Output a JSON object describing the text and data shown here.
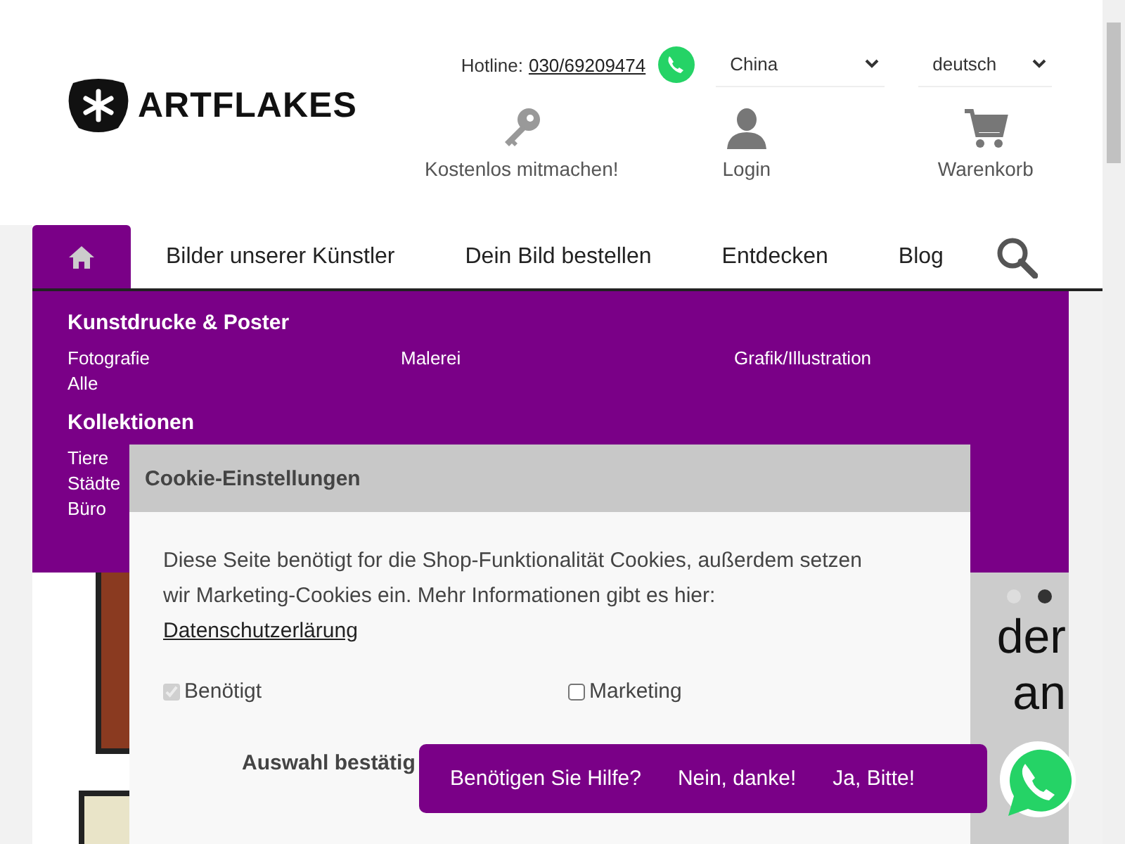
{
  "header": {
    "logo": "ARTFLAKES",
    "hotline_label": "Hotline:",
    "hotline_number": "030/69209474",
    "country": "China",
    "language": "deutsch",
    "actions": [
      {
        "kind": "key",
        "label": "Kostenlos mitmachen!"
      },
      {
        "kind": "user",
        "label": "Login"
      },
      {
        "kind": "cart",
        "label": "Warenkorb"
      }
    ]
  },
  "nav": {
    "items": [
      {
        "kind": "home",
        "selected": true
      },
      {
        "kind": "text",
        "label": "Bilder unserer Künstler",
        "selected": false
      },
      {
        "kind": "text",
        "label": "Dein Bild bestellen",
        "selected": false
      },
      {
        "kind": "text",
        "label": "Entdecken",
        "selected": false
      },
      {
        "kind": "text",
        "label": "Blog",
        "selected": false
      },
      {
        "kind": "search",
        "selected": false
      }
    ]
  },
  "mega_menu": {
    "sections": [
      {
        "title": "Kunstdrucke & Poster",
        "links": [
          "Fotografie",
          "Malerei",
          "Grafik/Illustration",
          "Alle"
        ],
        "kind": "grid"
      },
      {
        "title": "Kollektionen",
        "links": [
          "Tiere",
          "Städte",
          "Büro"
        ],
        "kind": "list"
      }
    ]
  },
  "hero": {
    "dots": [
      {
        "selected": false
      },
      {
        "selected": true
      }
    ],
    "text_lines": [
      "der",
      "an"
    ]
  },
  "cookie_dialog": {
    "title": "Cookie-Einstellungen",
    "text": "Diese Seite benötigt for die Shop-Funktionalität Cookies, außerdem setzen wir Marketing-Cookies ein. Mehr Informationen gibt es hier:",
    "link": "Datenschutzerlärung",
    "options": [
      {
        "label": "Benötigt",
        "checked": true,
        "disabled": true
      },
      {
        "label": "Marketing",
        "checked": false,
        "disabled": false
      }
    ],
    "confirm": "Auswahl bestätig"
  },
  "help_bar": {
    "question": "Benötigen Sie Hilfe?",
    "no": "Nein, danke!",
    "yes": "Ja, Bitte!"
  }
}
